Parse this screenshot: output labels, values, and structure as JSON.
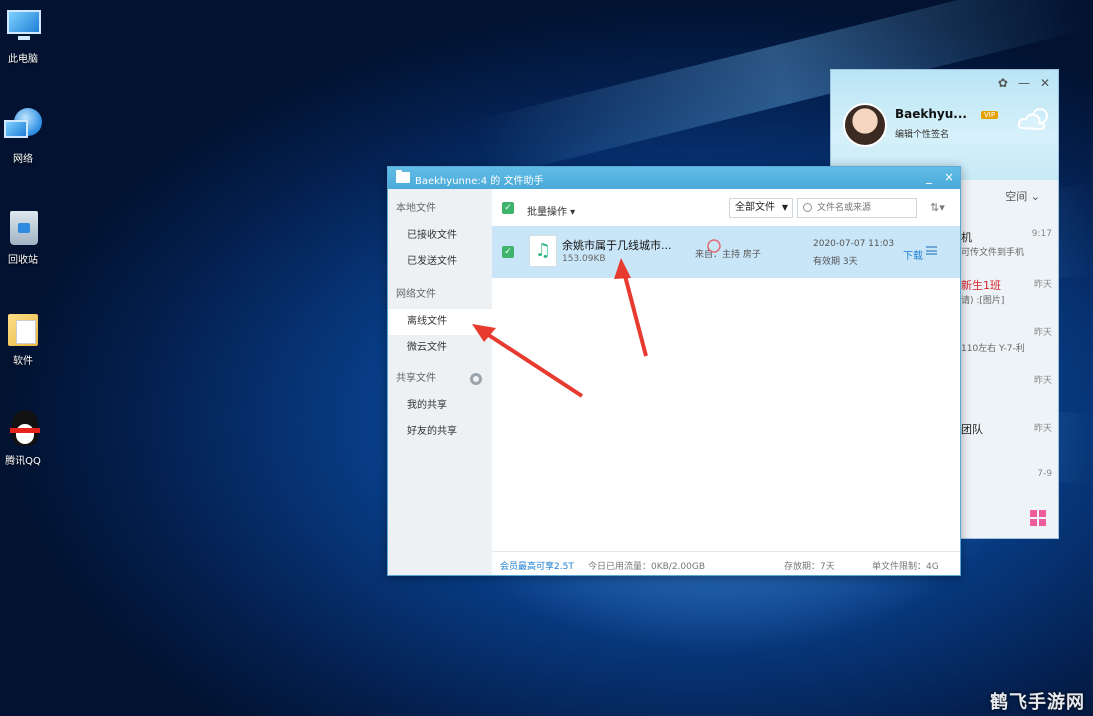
{
  "desktop": {
    "icons": [
      {
        "label": "此电脑",
        "icon": "computer-icon"
      },
      {
        "label": "网络",
        "icon": "network-icon"
      },
      {
        "label": "回收站",
        "icon": "recycle-bin-icon"
      },
      {
        "label": "软件",
        "icon": "folder-icon"
      },
      {
        "label": "腾讯QQ",
        "icon": "qq-penguin-icon"
      }
    ]
  },
  "qq_panel": {
    "nickname": "Baekhyu...",
    "vip_badge": "VIP",
    "signature": "编辑个性签名",
    "tab_space": "空间",
    "items": [
      {
        "title": "机",
        "preview": "可传文件到手机",
        "time": "9:17"
      },
      {
        "title": "新生1班",
        "preview": "请) :[图片]",
        "time": "昨天"
      },
      {
        "title": "",
        "preview": "110左右 Y-7-利",
        "time": "昨天"
      },
      {
        "title": "",
        "preview": "",
        "time": "昨天"
      },
      {
        "title": "团队",
        "preview": "",
        "time": "昨天"
      },
      {
        "title": "",
        "preview": "",
        "time": "7-9"
      }
    ],
    "colors": {
      "apps": "#ee5a9a"
    }
  },
  "file_assistant": {
    "title": "Baekhyunne:4 的 文件助手",
    "controls": {
      "minimize": "_",
      "close": "×"
    },
    "sidebar": {
      "group_local": "本地文件",
      "received": "已接收文件",
      "sent": "已发送文件",
      "group_network": "网络文件",
      "offline": "离线文件",
      "weiyun": "微云文件",
      "group_shared": "共享文件",
      "my_share": "我的共享",
      "friend_share": "好友的共享"
    },
    "toolbar": {
      "batch": "批量操作 ▾",
      "filter": "全部文件",
      "search_placeholder": "文件名或来源",
      "sort_icon": "⇅▾"
    },
    "file": {
      "name": "余姚市属于几线城市...",
      "size": "153.09KB",
      "source": "来自：主持 房子",
      "date": "2020-07-07 11:03",
      "expiry": "有效期 3天",
      "download": "下载"
    },
    "status": {
      "vip": "会员最高可享2.5T",
      "traffic": "今日已用流量：0KB/2.00GB",
      "retention": "存放期：7天",
      "limit": "单文件限制：4G"
    }
  },
  "watermark": "鹤飞手游网"
}
